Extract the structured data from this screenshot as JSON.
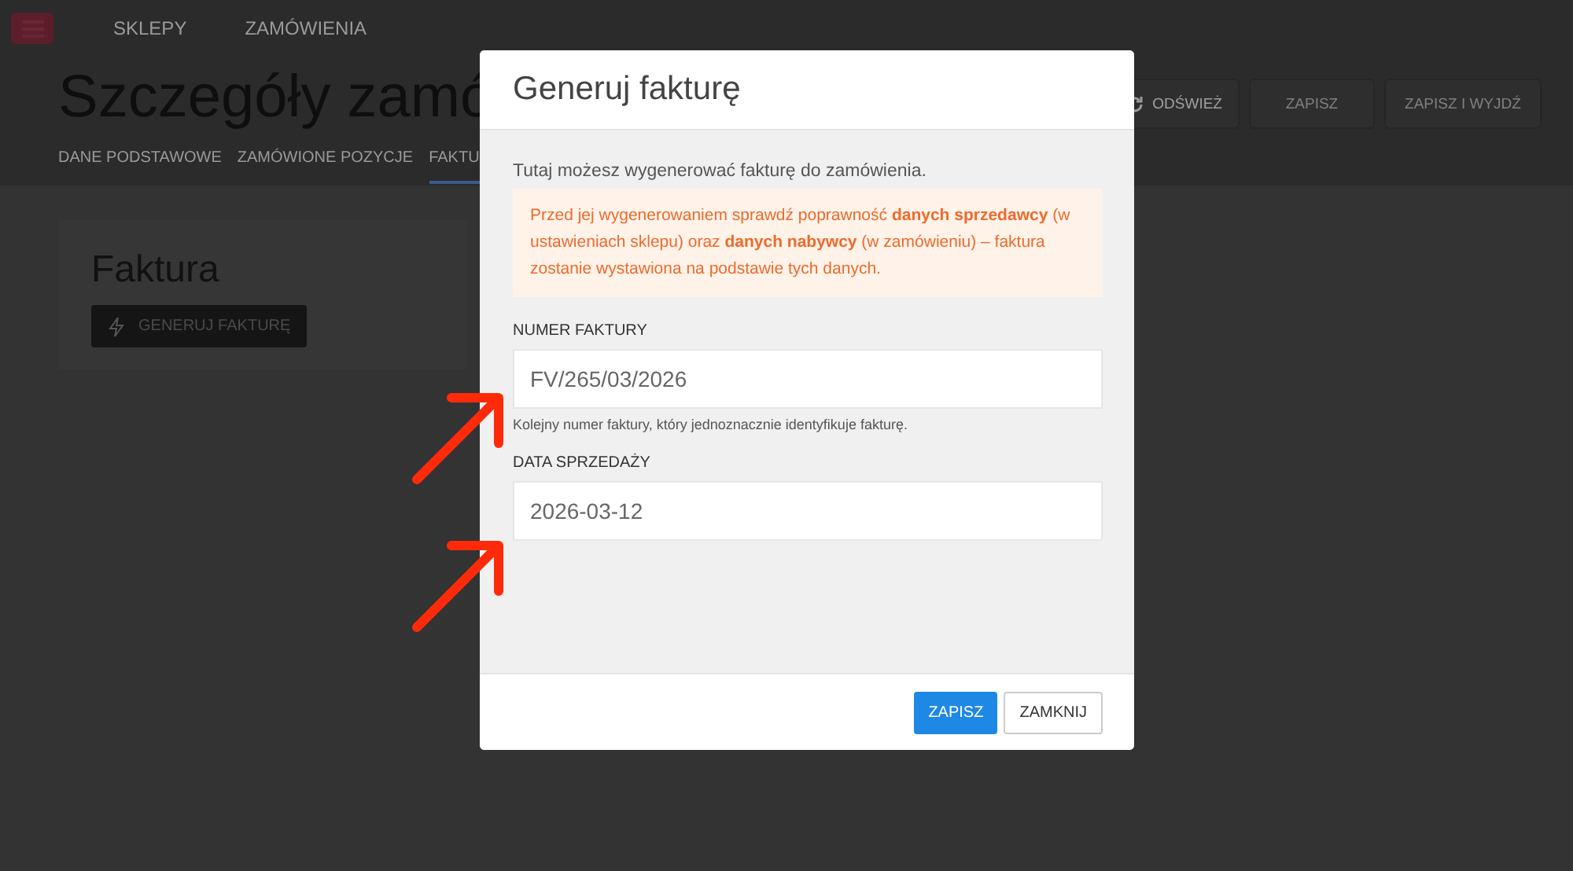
{
  "nav": {
    "items": [
      {
        "label": "SKLEPY"
      },
      {
        "label": "ZAMÓWIENIA"
      }
    ]
  },
  "page": {
    "title": "Szczegóły zamó",
    "actions": [
      {
        "label": "ODŚWIEŻ",
        "kind": "refresh"
      },
      {
        "label": "ZAPISZ",
        "kind": "plain"
      },
      {
        "label": "ZAPISZ I WYJDŹ",
        "kind": "plain"
      }
    ],
    "tabs": [
      {
        "label": "DANE PODSTAWOWE",
        "selected": false
      },
      {
        "label": "ZAMÓWIONE POZYCJE",
        "selected": false
      },
      {
        "label": "FAKTU",
        "selected": true
      }
    ],
    "card": {
      "title": "Faktura",
      "button": "GENERUJ FAKTURĘ"
    }
  },
  "dialog": {
    "title": "Generuj fakturę",
    "intro": "Tutaj możesz wygenerować fakturę do zamówienia.",
    "warning": "Przed jej wygenerowaniem sprawdź poprawność **danych sprzedawcy** (w ustawieniach sklepu) oraz **danych nabywcy** (w zamówieniu) – faktura zostanie wystawiona na podstawie tych danych.",
    "fields": [
      {
        "label": "NUMER FAKTURY",
        "value": "FV/265/03/2026",
        "help": "Kolejny numer faktury, który jednoznacznie identyfikuje fakturę."
      },
      {
        "label": "DATA SPRZEDAŻY",
        "value": "2026-03-12"
      }
    ],
    "buttons": [
      {
        "label": "ZAPISZ",
        "kind": "primary"
      },
      {
        "label": "ZAMKNIJ",
        "kind": "secondary"
      }
    ]
  },
  "annotations": {
    "arrows": [
      {
        "kind": "arrow"
      },
      {
        "kind": "arrow"
      }
    ]
  }
}
